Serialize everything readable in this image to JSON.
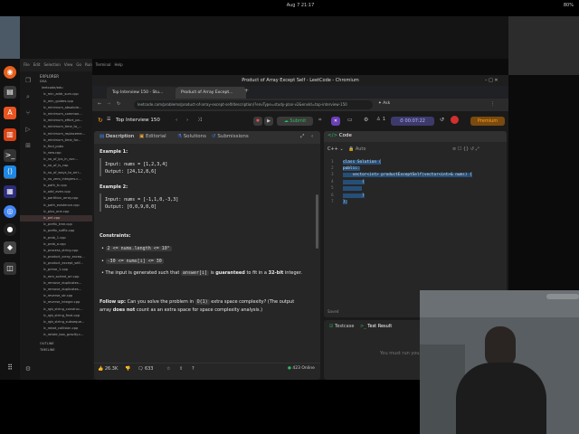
{
  "topbar": {
    "clock": "Aug 7  21:17",
    "battery": "80%"
  },
  "vscode": {
    "menu": [
      "File",
      "Edit",
      "Selection",
      "View",
      "Go",
      "Run",
      "Terminal",
      "Help"
    ],
    "explorer_title": "EXPLORER",
    "root": "DSA",
    "folder": "leetcode/edu",
    "files": [
      "lc_min_addr_sum.cpp",
      "lc_min_guides.cpp",
      "lc_minimum_absolute...",
      "lc_minimum_common...",
      "lc_minimum_effort_pa...",
      "lc_minimum_time_to_...",
      "lc_minimum_replaceme...",
      "lc_minimum_time_for...",
      "lc_find_pubs",
      "lc_new.cpp",
      "lc_no_of_ips_in_avc...",
      "lc_no_of_is_cap",
      "lc_no_of_ways_to_arri...",
      "lc_no_zero_integers.c...",
      "lc_path_tc.cpp",
      "lc_odd_even.cpp",
      "lc_partition_array.cpp",
      "lc_path_existence.cpp",
      "lc_plus_one.cpp",
      "lc_pnt.cpp",
      "lc_prefix_tree.cpp",
      "lc_prefix_suffix.cpp",
      "lc_prob_1.cpp",
      "lc_prob_a.cpp",
      "lc_process_string.cpp",
      "lc_product_array_excep...",
      "lc_product_except_self...",
      "lc_prime_1.cpp",
      "lc_rem_sorted_arr.cpp",
      "lc_remove_duplicates...",
      "lc_remove_duplicates...",
      "lc_reverse_str.cpp",
      "lc_reverse_integer.cpp",
      "lc_rgb_string_construc...",
      "lc_rgb_string_final.cpp",
      "lc_rgb_string_subseque...",
      "lc_robot_collision.cpp",
      "lc_rotate_box_gravity.c..."
    ],
    "selected_index": 19,
    "outline": "OUTLINE",
    "timeline": "TIMELINE"
  },
  "chrome": {
    "title": "Product of Array Except Self - LeetCode - Chromium",
    "tabs": [
      "Top Interview 150 - Stu...",
      "Product of Array Except..."
    ],
    "url": "leetcode.com/problems/product-of-array-except-self/description/?envType=study-plan-v2&envId=top-interview-150"
  },
  "lcnav": {
    "list": "Top Interview 150",
    "submit": "Submit",
    "timer": "00:07:22",
    "premium": "Premium",
    "count": "1"
  },
  "desc": {
    "tabs": [
      "Description",
      "Editorial",
      "Solutions",
      "Submissions"
    ],
    "ex1_title": "Example 1:",
    "ex1_input": "Input: nums = [1,2,3,4]",
    "ex1_output": "Output: [24,12,8,6]",
    "ex2_title": "Example 2:",
    "ex2_input": "Input: nums = [-1,1,0,-3,3]",
    "ex2_output": "Output: [0,0,9,0,0]",
    "constraints": "Constraints:",
    "c1": "2 <= nums.length <= 10⁵",
    "c2": "-30 <= nums[i] <= 30",
    "c3_pre": "The input is generated such that",
    "c3_code": "answer[i]",
    "c3_mid": "is",
    "c3_bold": "guaranteed",
    "c3_post": "to fit in a",
    "c3_bold2": "32-bit",
    "c3_end": "integer.",
    "fu_bold": "Follow up:",
    "fu_pre": "Can you solve the problem in",
    "fu_code": "O(1)",
    "fu_post": "extra space complexity? (The output",
    "fu_line2_pre": "array",
    "fu_line2_bold": "does not",
    "fu_line2_post": "count as an extra space for space complexity analysis.)"
  },
  "bottom": {
    "likes": "26.3K",
    "comments": "633",
    "online": "423 Online"
  },
  "code": {
    "title": "Code",
    "lang": "C++",
    "auto": "Auto",
    "lines": [
      "class Solution {",
      "public:",
      "    vector<int> productExceptSelf(vector<int>& nums) {",
      "        {",
      "        ",
      "        }",
      "};"
    ],
    "saved": "Saved"
  },
  "testcase": {
    "tab1": "Testcase",
    "tab2": "Test Result",
    "placeholder": "You must run you..."
  }
}
